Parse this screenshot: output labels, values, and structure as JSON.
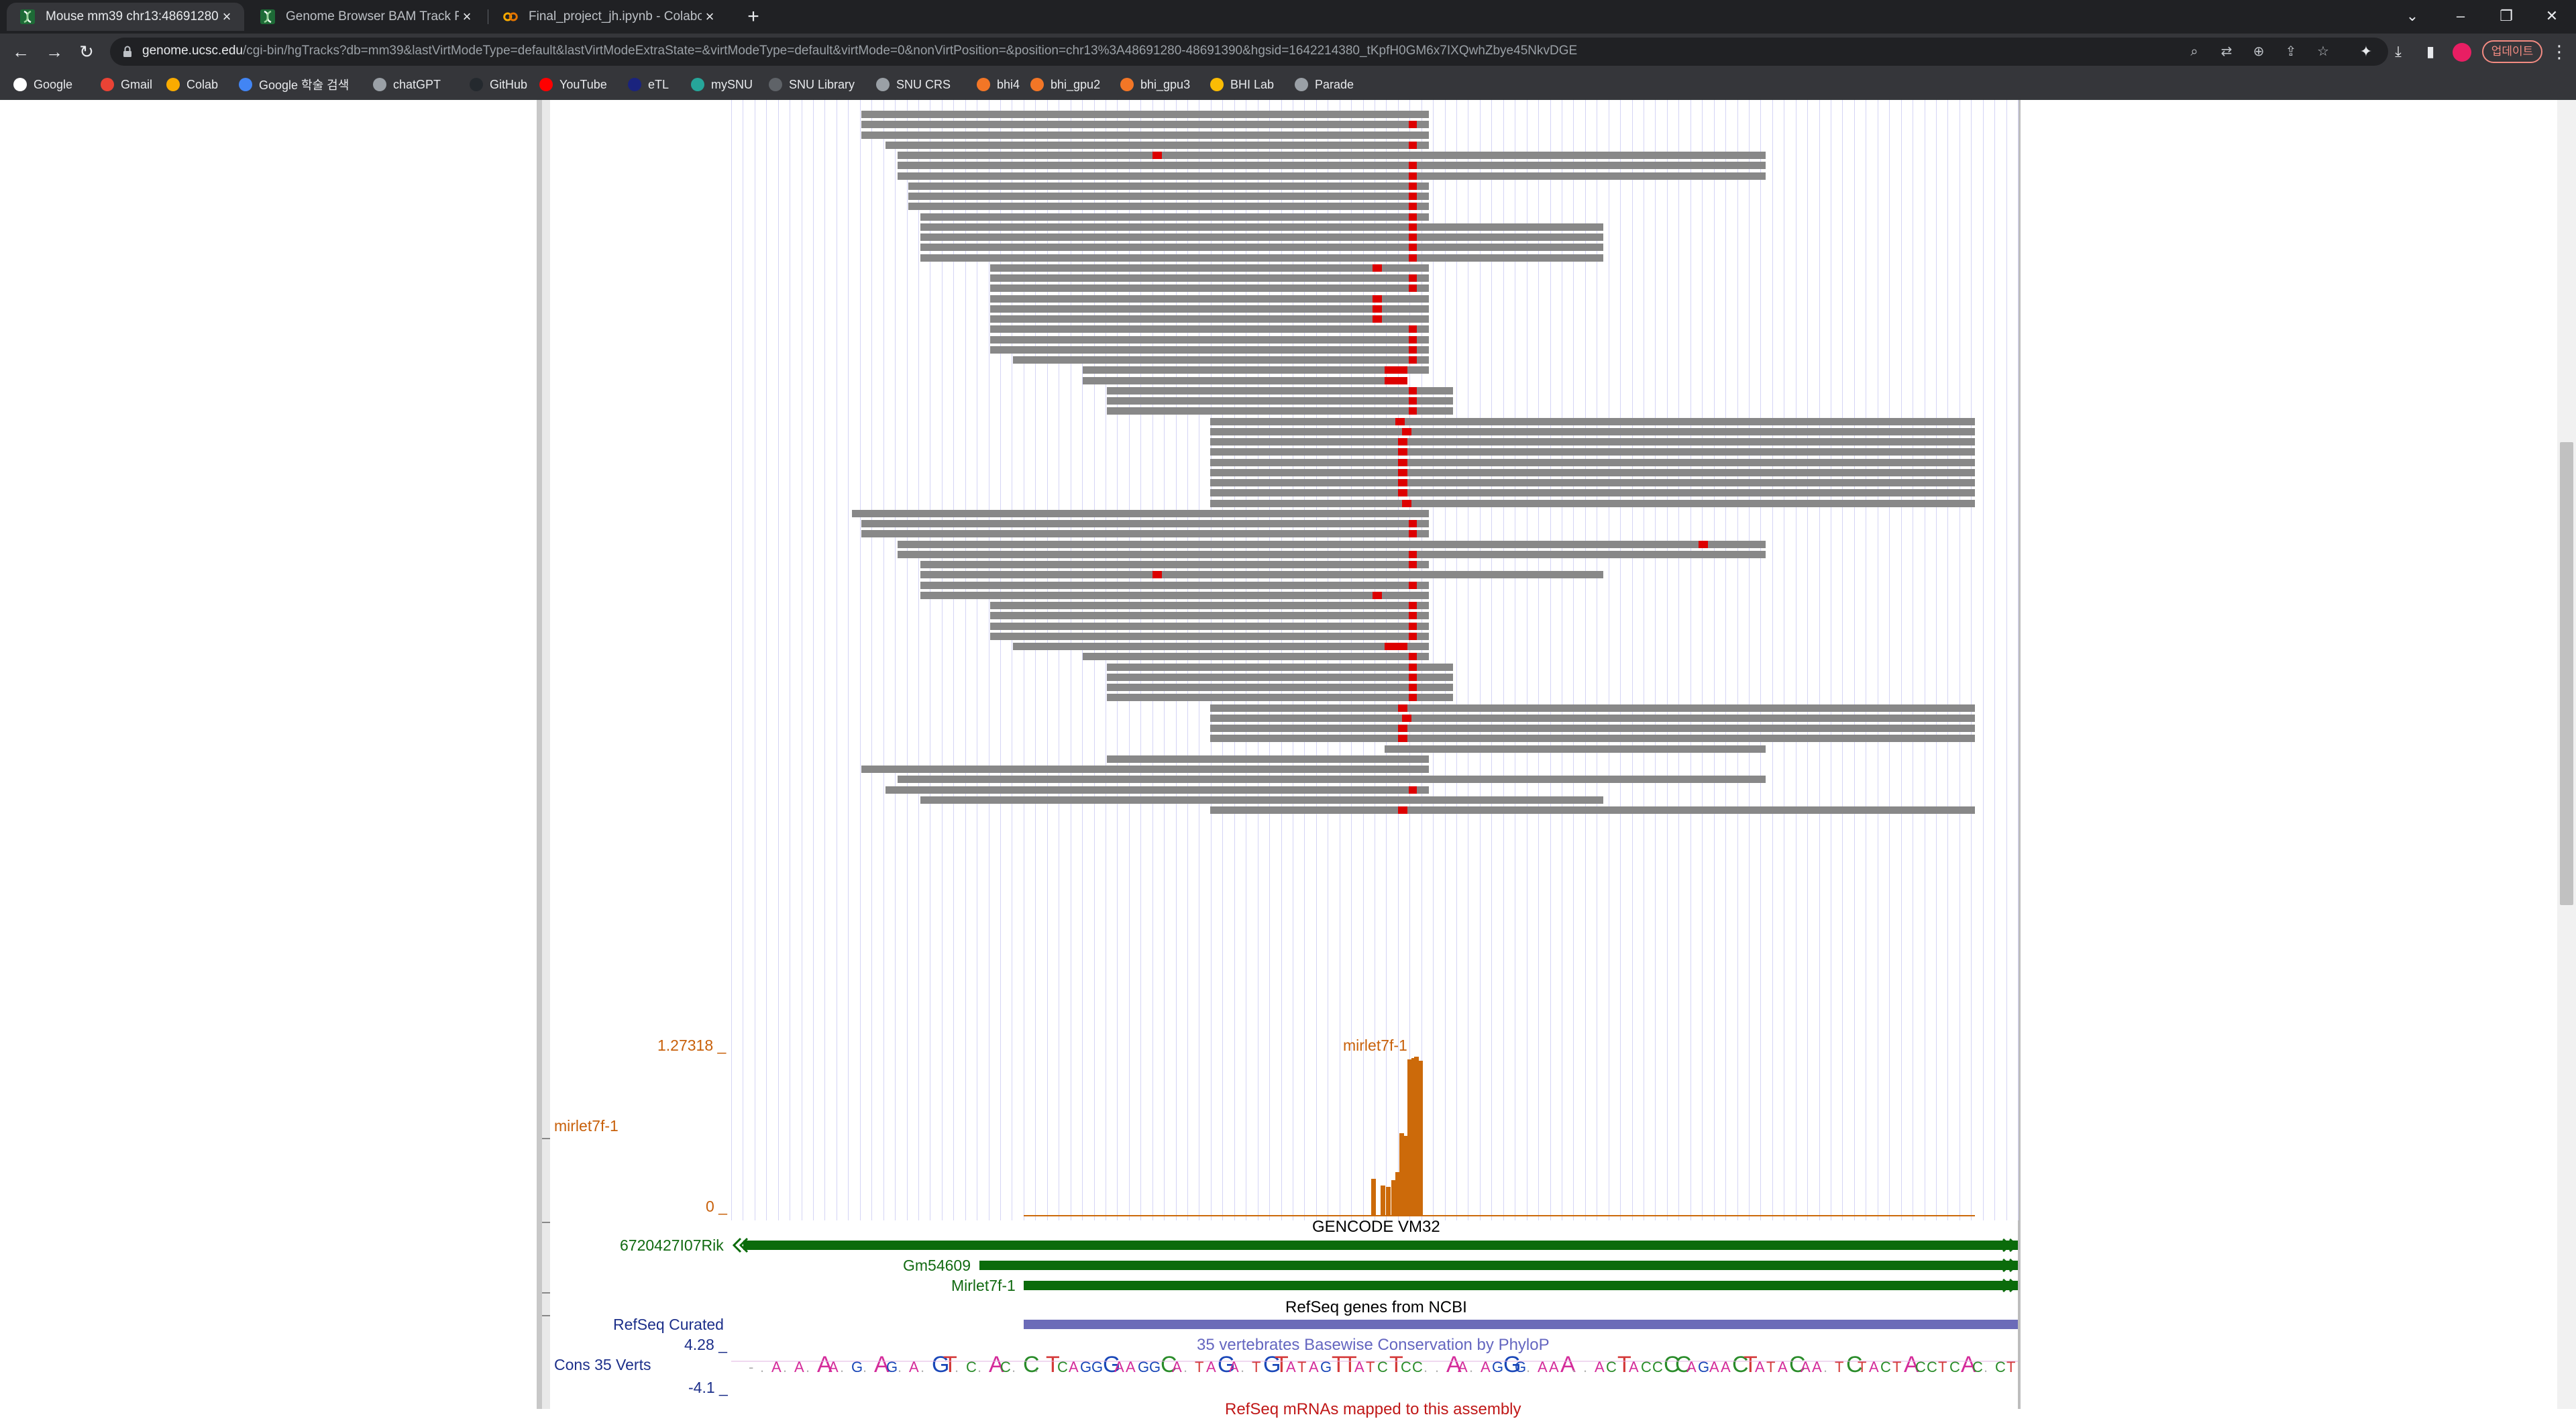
{
  "browser": {
    "tabs": [
      {
        "title": "Mouse mm39 chr13:48691280-",
        "active": true,
        "icon": "ucsc-helix-icon"
      },
      {
        "title": "Genome Browser BAM Track Fo",
        "active": false,
        "icon": "ucsc-helix-icon"
      },
      {
        "title": "Final_project_jh.ipynb - Colabo",
        "active": false,
        "icon": "colab-icon"
      }
    ],
    "url_host": "genome.ucsc.edu",
    "url_path": "/cgi-bin/hgTracks?db=mm39&lastVirtModeType=default&lastVirtModeExtraState=&virtModeType=default&virtMode=0&nonVirtPosition=&position=chr13%3A48691280-48691390&hgsid=1642214380_tKpfH0GM6x7IXQwhZbye45NkvDGE",
    "update_label": "업데이트",
    "bookmarks": [
      {
        "label": "Google",
        "icon": "google-icon",
        "color": "#ffffff"
      },
      {
        "label": "Gmail",
        "icon": "gmail-icon",
        "color": "#ea4335"
      },
      {
        "label": "Colab",
        "icon": "colab-icon",
        "color": "#f9ab00"
      },
      {
        "label": "Google 학술 검색",
        "icon": "scholar-icon",
        "color": "#4285f4"
      },
      {
        "label": "chatGPT",
        "icon": "chatgpt-icon",
        "color": "#9aa0a6"
      },
      {
        "label": "GitHub",
        "icon": "github-icon",
        "color": "#24292e"
      },
      {
        "label": "YouTube",
        "icon": "youtube-icon",
        "color": "#ff0000"
      },
      {
        "label": "eTL",
        "icon": "etl-icon",
        "color": "#1a237e"
      },
      {
        "label": "mySNU",
        "icon": "mysnu-icon",
        "color": "#26a69a"
      },
      {
        "label": "SNU Library",
        "icon": "library-icon",
        "color": "#5f6368"
      },
      {
        "label": "SNU CRS",
        "icon": "globe-icon",
        "color": "#9aa0a6"
      },
      {
        "label": "bhi4",
        "icon": "jupyter-icon",
        "color": "#f37626"
      },
      {
        "label": "bhi_gpu2",
        "icon": "jupyter-icon",
        "color": "#f37626"
      },
      {
        "label": "bhi_gpu3",
        "icon": "jupyter-icon",
        "color": "#f37626"
      },
      {
        "label": "BHI Lab",
        "icon": "lab-icon",
        "color": "#fbbc04"
      },
      {
        "label": "Parade",
        "icon": "globe-icon",
        "color": "#9aa0a6"
      }
    ]
  },
  "genome_browser": {
    "read_color": "#888888",
    "mismatch_color": "#dd0000",
    "signal_track": {
      "name": "mirlet7f-1",
      "peak_label": "mirlet7f-1",
      "max_value": "1.27318 _",
      "min_value": "0 _",
      "color": "#cc6a0a"
    },
    "gencode": {
      "title": "GENCODE VM32",
      "genes": [
        "6720427I07Rik",
        "Gm54609",
        "Mirlet7f-1"
      ],
      "color": "#0b6b0b"
    },
    "refseq": {
      "label": "RefSeq Curated",
      "title": "RefSeq genes from NCBI",
      "color": "#6b6bb8"
    },
    "conservation": {
      "label": "Cons 35 Verts",
      "title": "35 vertebrates Basewise Conservation by PhyloP",
      "max_value": "4.28 _",
      "min_value": "-4.1 _",
      "sequence": "-.A.A.AA.G.AG.A.GT.C.AC.C.TCAGGGAAGGCA.TAGA.TGTATAGTTATCTCC..AA.AGGG.AAA..ACTACCCCAGAACTATACAA.TCTACTACCTCAC.CT"
    },
    "cut_off_title": "RefSeq mRNAs mapped to this assembly"
  }
}
